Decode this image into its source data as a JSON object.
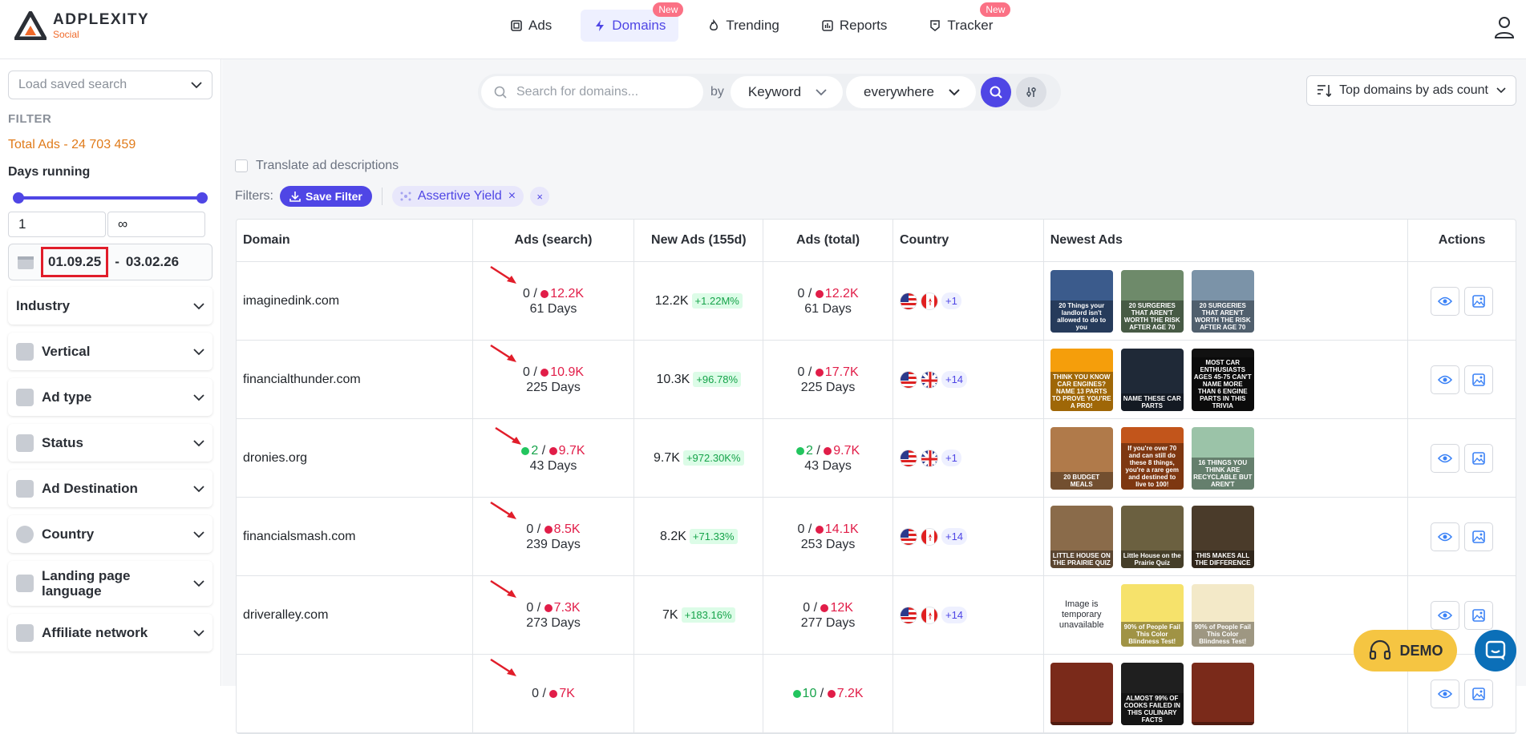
{
  "header": {
    "brand": "ADPLEXITY",
    "brand_sub": "Social",
    "nav": [
      {
        "label": "Ads",
        "badge": ""
      },
      {
        "label": "Domains",
        "badge": "New"
      },
      {
        "label": "Trending",
        "badge": ""
      },
      {
        "label": "Reports",
        "badge": ""
      },
      {
        "label": "Tracker",
        "badge": "New"
      }
    ],
    "accent": "#4f46e5"
  },
  "sidebar": {
    "saved_search_placeholder": "Load saved search",
    "filter_title": "FILTER",
    "total_ads": "Total Ads - 24 703 459",
    "days_running_title": "Days running",
    "days_min": "1",
    "days_max": "∞",
    "date_start": "01.09.25",
    "date_sep": "-",
    "date_end": "03.02.26",
    "accordions": [
      {
        "label": "Industry",
        "icon": "none"
      },
      {
        "label": "Vertical",
        "icon": "vertical-icon"
      },
      {
        "label": "Ad type",
        "icon": "ad-type-icon"
      },
      {
        "label": "Status",
        "icon": "status-icon"
      },
      {
        "label": "Ad Destination",
        "icon": "ad-destination-icon"
      },
      {
        "label": "Country",
        "icon": "globe-icon"
      },
      {
        "label": "Landing page language",
        "icon": "language-icon"
      },
      {
        "label": "Affiliate network",
        "icon": "affiliate-icon"
      }
    ]
  },
  "search": {
    "placeholder": "Search for domains...",
    "by_label": "by",
    "keyword_select": "Keyword",
    "scope_select": "everywhere",
    "sort_select": "Top domains by ads count"
  },
  "filters": {
    "translate_label": "Translate ad descriptions",
    "filters_label": "Filters:",
    "save_filter_label": "Save Filter",
    "chip_label": "Assertive Yield",
    "chip_close": "×",
    "clear_all": "×"
  },
  "table": {
    "headers": {
      "domain": "Domain",
      "search": "Ads (search)",
      "new": "New Ads (155d)",
      "total": "Ads (total)",
      "country": "Country",
      "newest": "Newest Ads",
      "actions": "Actions"
    },
    "rows": [
      {
        "domain": "imaginedink.com",
        "search_active": "0",
        "search_total": "12.2K",
        "search_days": "61 Days",
        "new_ads": "12.2K",
        "growth": "+1.22M%",
        "total_active": "0",
        "total_total": "12.2K",
        "total_days": "61 Days",
        "flags": [
          "us",
          "ca"
        ],
        "more": "+1",
        "thumbs": [
          {
            "text": "20 Things your landlord isn't allowed to do to you",
            "color": "#3b5b8c"
          },
          {
            "text": "20 SURGERIES THAT AREN'T WORTH THE RISK AFTER AGE 70",
            "color": "#6e8a6a"
          },
          {
            "text": "20 SURGERIES THAT AREN'T WORTH THE RISK AFTER AGE 70",
            "color": "#7b93a8"
          }
        ]
      },
      {
        "domain": "financialthunder.com",
        "search_active": "0",
        "search_total": "10.9K",
        "search_days": "225 Days",
        "new_ads": "10.3K",
        "growth": "+96.78%",
        "total_active": "0",
        "total_total": "17.7K",
        "total_days": "225 Days",
        "flags": [
          "us",
          "gb"
        ],
        "more": "+14",
        "thumbs": [
          {
            "text": "THINK YOU KNOW CAR ENGINES? NAME 13 PARTS TO PROVE YOU'RE A PRO!",
            "color": "#f59e0b"
          },
          {
            "text": "NAME THESE CAR PARTS",
            "color": "#1f2937"
          },
          {
            "text": "MOST CAR ENTHUSIASTS AGES 45-75 CAN'T NAME MORE THAN 6 ENGINE PARTS IN THIS TRIVIA",
            "color": "#111111"
          }
        ]
      },
      {
        "domain": "dronies.org",
        "search_active": "2",
        "search_total": "9.7K",
        "search_days": "43 Days",
        "new_ads": "9.7K",
        "growth": "+972.30K%",
        "total_active": "2",
        "total_total": "9.7K",
        "total_days": "43 Days",
        "flags": [
          "us",
          "gb"
        ],
        "more": "+1",
        "thumbs": [
          {
            "text": "20 BUDGET MEALS",
            "color": "#b07a4a"
          },
          {
            "text": "If you're over 70 and can still do these 8 things, you're a rare gem and destined to live to 100!",
            "color": "#c2551b"
          },
          {
            "text": "16 THINGS YOU THINK ARE RECYCLABLE BUT AREN'T",
            "color": "#9bc3a8"
          }
        ]
      },
      {
        "domain": "financialsmash.com",
        "search_active": "0",
        "search_total": "8.5K",
        "search_days": "239 Days",
        "new_ads": "8.2K",
        "growth": "+71.33%",
        "total_active": "0",
        "total_total": "14.1K",
        "total_days": "253 Days",
        "flags": [
          "us",
          "ca"
        ],
        "more": "+14",
        "thumbs": [
          {
            "text": "LITTLE HOUSE ON THE PRAIRIE QUIZ",
            "color": "#8a6b4a"
          },
          {
            "text": "Little House on the Prairie Quiz",
            "color": "#6b6040"
          },
          {
            "text": "THIS MAKES ALL THE DIFFERENCE",
            "color": "#4a3b2a"
          }
        ]
      },
      {
        "domain": "driveralley.com",
        "search_active": "0",
        "search_total": "7.3K",
        "search_days": "273 Days",
        "new_ads": "7K",
        "growth": "+183.16%",
        "total_active": "0",
        "total_total": "12K",
        "total_days": "277 Days",
        "flags": [
          "us",
          "ca"
        ],
        "more": "+14",
        "thumbs": [
          {
            "text": "Image is temporary unavailable",
            "color": "na"
          },
          {
            "text": "90% of People Fail This Color Blindness Test!",
            "color": "#f6e26b"
          },
          {
            "text": "90% of People Fail This Color Blindness Test!",
            "color": "#f3e9c8"
          }
        ]
      },
      {
        "domain": "",
        "search_active": "0",
        "search_total": "7K",
        "search_days": "",
        "new_ads": "",
        "growth": "",
        "total_active": "10",
        "total_total": "7.2K",
        "total_days": "",
        "flags": [],
        "more": "",
        "thumbs": [
          {
            "text": "",
            "color": "#7a2a1a"
          },
          {
            "text": "ALMOST 99% OF COOKS FAILED IN THIS CULINARY FACTS",
            "color": "#1f1f1f"
          },
          {
            "text": "",
            "color": "#7a2a1a"
          }
        ]
      }
    ]
  },
  "floating": {
    "demo_label": "DEMO"
  }
}
